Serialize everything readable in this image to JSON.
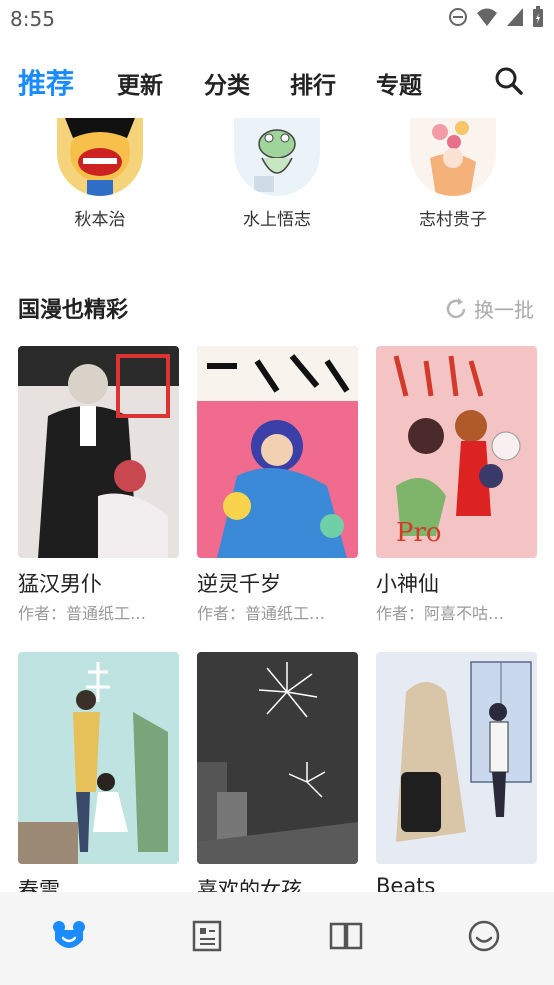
{
  "status": {
    "time": "8:55"
  },
  "nav": {
    "tabs": [
      {
        "label": "推荐",
        "active": true
      },
      {
        "label": "更新"
      },
      {
        "label": "分类"
      },
      {
        "label": "排行"
      },
      {
        "label": "专题"
      }
    ]
  },
  "authors": [
    {
      "name": "秋本治"
    },
    {
      "name": "水上悟志"
    },
    {
      "name": "志村贵子"
    }
  ],
  "section": {
    "title": "国漫也精彩",
    "refresh_label": "换一批"
  },
  "comics": [
    {
      "title": "猛汉男仆",
      "author": "作者：普通纸工…",
      "cover_color": "#e7e2e0"
    },
    {
      "title": "逆灵千岁",
      "author": "作者：普通纸工…",
      "cover_color": "#f06b8e"
    },
    {
      "title": "小神仙",
      "author": "作者：阿喜不咕…",
      "cover_color": "#f4c4c4"
    },
    {
      "title": "春雪",
      "author": "",
      "cover_color": "#bfe3e1"
    },
    {
      "title": "喜欢的女孩…",
      "author": "",
      "cover_color": "#3a3a3a"
    },
    {
      "title": "Beats",
      "author": "",
      "cover_color": "#e6eaf2"
    }
  ],
  "colors": {
    "accent": "#1a8cff"
  },
  "bottom_nav": [
    {
      "icon": "bear-icon",
      "active": true
    },
    {
      "icon": "document-icon"
    },
    {
      "icon": "book-icon"
    },
    {
      "icon": "smile-icon"
    }
  ]
}
